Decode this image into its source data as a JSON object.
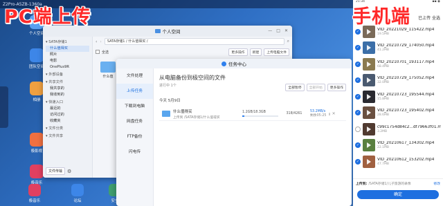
{
  "desktop": {
    "title": "Z2Pro-A5ZB-1360a",
    "icons": [
      {
        "label": "个人空间",
        "color": "#5aa0f0"
      },
      {
        "label": "团队空间",
        "color": "#3d86e8"
      },
      {
        "label": "相册",
        "color": "#f0a040"
      },
      {
        "label": "极影视",
        "color": "#f07040"
      },
      {
        "label": "极音乐",
        "color": "#e04060"
      }
    ],
    "taskbar": [
      "极音乐",
      "论坛",
      "安全"
    ]
  },
  "overlay": {
    "left_title": "PC端上传",
    "right_title": "手机端"
  },
  "file_manager": {
    "title": "个人空间",
    "window_controls": [
      "—",
      "□",
      "✕"
    ],
    "sidebar": [
      {
        "label": "SATA存储1",
        "type": "hdr"
      },
      {
        "label": "什么值得买",
        "type": "sub",
        "selected": true
      },
      {
        "label": "照片",
        "type": "sub"
      },
      {
        "label": "电影",
        "type": "sub"
      },
      {
        "label": "OnePlus9R",
        "type": "sub"
      },
      {
        "label": "外部设备",
        "type": "hdr"
      },
      {
        "label": "共享文件",
        "type": "hdr"
      },
      {
        "label": "我共享的",
        "type": "sub"
      },
      {
        "label": "我收到的",
        "type": "sub"
      },
      {
        "label": "快速入口",
        "type": "hdr"
      },
      {
        "label": "最近的",
        "type": "sub"
      },
      {
        "label": "访问过的",
        "type": "sub"
      },
      {
        "label": "收藏夹",
        "type": "sub"
      },
      {
        "label": "文件分类",
        "type": "hdr"
      },
      {
        "label": "文件共享",
        "type": "hdr"
      }
    ],
    "sidebar_bottom": "文件传输",
    "path": "SATA存储1 / 什么值得买 /",
    "select_all": "全选",
    "actions": [
      "更多操作",
      "新建",
      "上传电脑文件"
    ],
    "file_name": "什么值"
  },
  "task_center": {
    "title": "任务中心",
    "nav": [
      {
        "label": "文件处理",
        "active": false
      },
      {
        "label": "上传任务",
        "active": true
      },
      {
        "label": "下载到电脑",
        "active": false
      },
      {
        "label": "网盘任务",
        "active": false
      },
      {
        "label": "FTP备份",
        "active": false
      },
      {
        "label": "闪电传",
        "active": false
      }
    ],
    "heading": "从电脑备份到极空间的文件",
    "subheading": "进行中 1个",
    "buttons": [
      "全部暂停",
      "全部开始",
      "更多操作"
    ],
    "date": "今天 5月9日",
    "task": {
      "name": "什么值得买",
      "path": "上传到 /SATA存储1/什么值得买",
      "size": "1.2GB/18.3GB",
      "count": "318/4261",
      "speed": "53.2MB/s",
      "eta": "剩余05:25",
      "progress": 0.066
    }
  },
  "phone": {
    "status_left": "21:34",
    "status_right": "▪▪ ◉",
    "header_left": "✕",
    "header_right": "已上传 全选",
    "items": [
      {
        "name": "VID_20221029_115422.mp4",
        "size": "19.5MB",
        "checked": true,
        "color": "#7a6a58"
      },
      {
        "name": "VID_20210729_174050.mp4",
        "size": "41.2MB",
        "checked": true,
        "color": "#3c6fa8"
      },
      {
        "name": "VID_20210701_193117.mp4",
        "size": "68.4MB",
        "checked": true,
        "color": "#8a7a50"
      },
      {
        "name": "VID_20210729_175052.mp4",
        "size": "32.0MB",
        "checked": true,
        "color": "#4a5a70"
      },
      {
        "name": "VID_20210723_195544.mp4",
        "size": "15.8MB",
        "checked": true,
        "color": "#2a2a30"
      },
      {
        "name": "VID_20210723_195402.mp4",
        "size": "28.6MB",
        "checked": true,
        "color": "#6a5040"
      },
      {
        "name": "c99c1754d84c2...df79663f01.mp4",
        "size": "3.2MB",
        "checked": false,
        "color": "#503a30"
      },
      {
        "name": "VID_20210617_134302.mp4",
        "size": "22.1MB",
        "checked": true,
        "color": "#5a8040"
      },
      {
        "name": "VID_20210612_153202.mp4",
        "size": "47.7MB",
        "checked": true,
        "color": "#a06040"
      }
    ],
    "upload_label": "上传到:",
    "upload_path": "/SATA存储1/儿子旅游的录像",
    "modify": "修改",
    "confirm": "确定"
  }
}
